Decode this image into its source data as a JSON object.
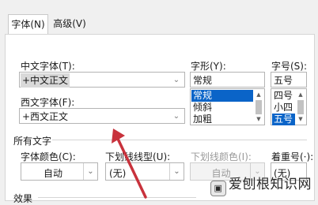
{
  "tabs": [
    {
      "label": "字体(N)"
    },
    {
      "label": "高级(V)"
    }
  ],
  "chinese_font": {
    "label": "中文字体(T):",
    "value": "+中文正文"
  },
  "western_font": {
    "label": "西文字体(F):",
    "value": "+西文正文"
  },
  "font_style": {
    "label": "字形(Y):",
    "value": "常规",
    "options": [
      "常规",
      "倾斜",
      "加粗"
    ],
    "selected": "常规"
  },
  "font_size": {
    "label": "字号(S):",
    "value": "五号",
    "options": [
      "四号",
      "小四",
      "五号"
    ],
    "selected": "五号"
  },
  "all_text": {
    "section_label": "所有文字",
    "font_color": {
      "label": "字体颜色(C):",
      "value": "自动"
    },
    "underline_style": {
      "label": "下划线线型(U):",
      "value": "(无)"
    },
    "underline_color": {
      "label": "下划线颜色(I):",
      "value": "自动"
    },
    "emphasis": {
      "label": "着重号(·):",
      "value": "(无)"
    }
  },
  "effects": {
    "section_label": "效果"
  },
  "watermark": {
    "text": "爱刨根知识网"
  },
  "colors": {
    "selection": "#0a64c8",
    "arrow": "#c8323c"
  }
}
